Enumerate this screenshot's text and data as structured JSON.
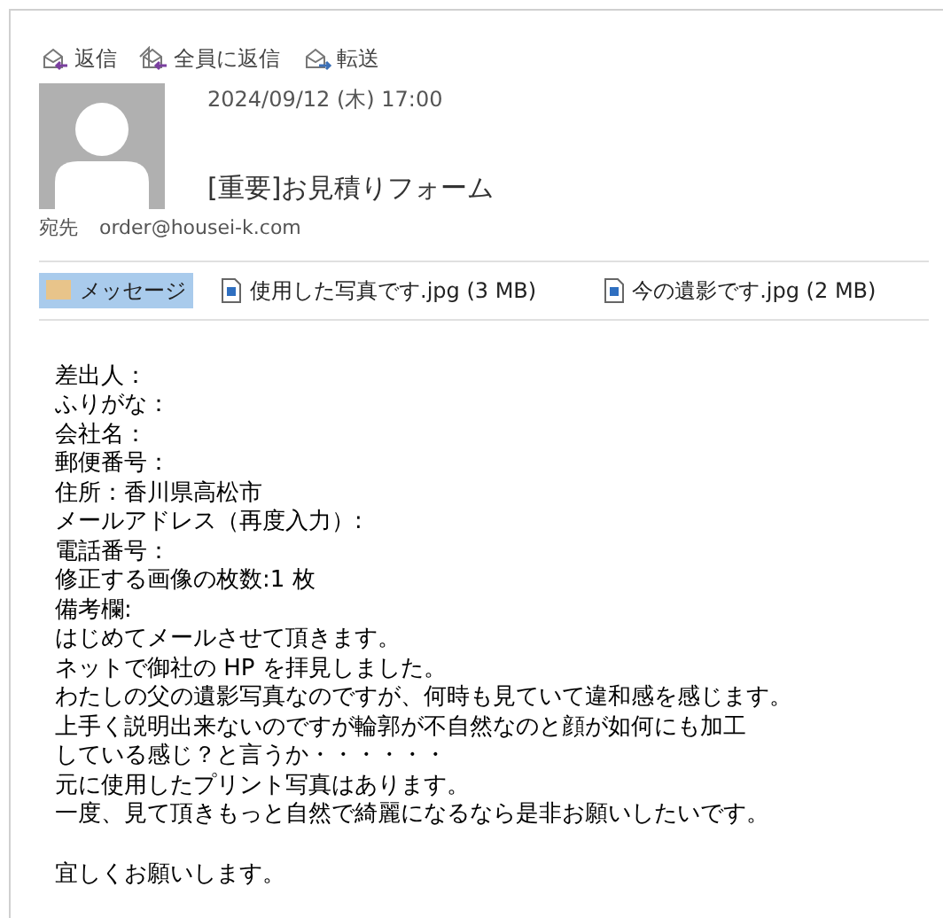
{
  "toolbar": [
    {
      "label": "返信",
      "kind": "reply"
    },
    {
      "label": "全員に返信",
      "kind": "reply-all"
    },
    {
      "label": "転送",
      "kind": "forward"
    }
  ],
  "message": {
    "date": "2024/09/12 (木) 17:00",
    "subject": "[重要]お見積りフォーム",
    "to_label": "宛先",
    "to": "order@housei-k.com"
  },
  "attachments": [
    {
      "label": "メッセージ",
      "kind": "message",
      "selected": true
    },
    {
      "label": "使用した写真です.jpg (3 MB)",
      "kind": "file",
      "selected": false
    },
    {
      "label": "今の遺影です.jpg (2 MB)",
      "kind": "file",
      "selected": false
    }
  ],
  "body": [
    [
      "差出人：",
      "ふりがな：",
      "会社名：",
      "郵便番号：",
      "住所：香川県高松市",
      "メールアドレス（再度入力）:",
      "電話番号：",
      "修正する画像の枚数:1 枚",
      "備考欄:",
      "はじめてメールさせて頂きます。",
      "ネットで御社の HP を拝見しました。",
      "わたしの父の遺影写真なのですが、何時も見ていて違和感を感じます。",
      "上手く説明出来ないのですが輪郭が不自然なのと顔が如何にも加工",
      "している感じ？と言うか・・・・・・",
      "元に使用したプリント写真はあります。",
      "一度、見て頂きもっと自然で綺麗になるなら是非お願いしたいです。"
    ],
    [
      "宜しくお願いします。"
    ]
  ]
}
